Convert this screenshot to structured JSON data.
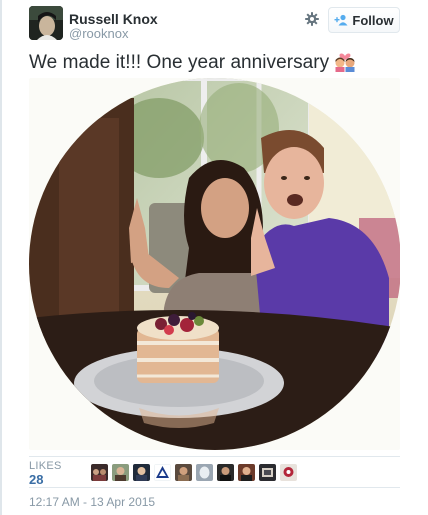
{
  "tweet": {
    "user": {
      "display_name": "Russell Knox",
      "handle": "@rooknox"
    },
    "follow_label": "Follow",
    "text": "We made it!!! One year anniversary",
    "emoji": "couple-with-heart-icon",
    "likes": {
      "label": "LIKES",
      "count": "28",
      "liker_avatars": 10
    },
    "timestamp": "12:17 AM - 13 Apr 2015"
  },
  "colors": {
    "text": "#292f33",
    "muted": "#8899a6",
    "link": "#3a6ea5",
    "border": "#e1e8ed"
  }
}
